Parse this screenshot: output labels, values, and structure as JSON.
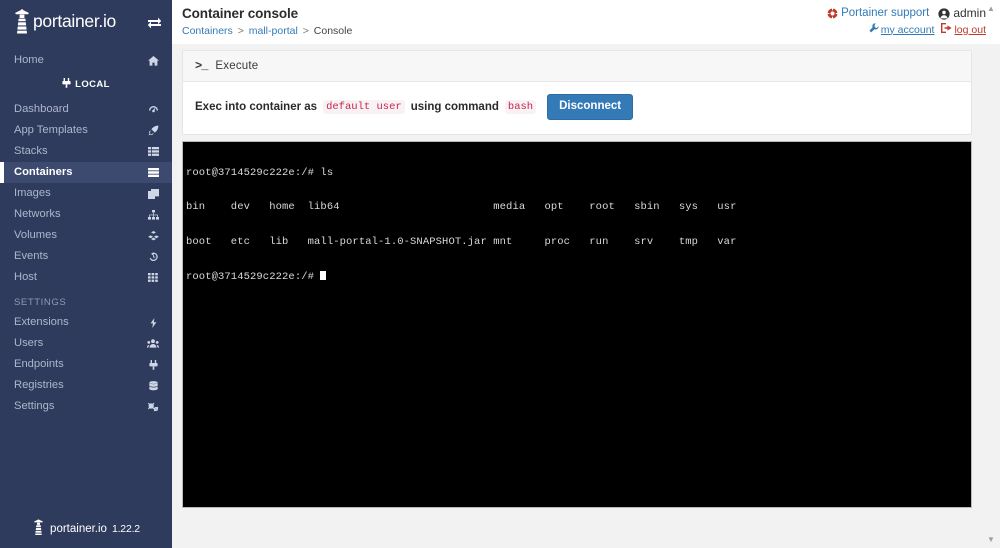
{
  "brand": {
    "name": "portainer.io",
    "version": "1.22.2",
    "toggle_icon": "exchange-arrows-icon",
    "logo_icon": "lighthouse-logo-icon"
  },
  "sidebar": {
    "home": {
      "label": "Home",
      "icon": "home-icon"
    },
    "endpoint": {
      "label": "LOCAL",
      "icon": "plug-icon"
    },
    "items": [
      {
        "label": "Dashboard",
        "icon": "tachometer-icon",
        "active": false
      },
      {
        "label": "App Templates",
        "icon": "rocket-icon",
        "active": false
      },
      {
        "label": "Stacks",
        "icon": "th-list-icon",
        "active": false
      },
      {
        "label": "Containers",
        "icon": "server-icon",
        "active": true
      },
      {
        "label": "Images",
        "icon": "clone-icon",
        "active": false
      },
      {
        "label": "Networks",
        "icon": "sitemap-icon",
        "active": false
      },
      {
        "label": "Volumes",
        "icon": "cubes-icon",
        "active": false
      },
      {
        "label": "Events",
        "icon": "history-icon",
        "active": false
      },
      {
        "label": "Host",
        "icon": "th-icon",
        "active": false
      }
    ],
    "settings_title": "SETTINGS",
    "settings_items": [
      {
        "label": "Extensions",
        "icon": "bolt-icon"
      },
      {
        "label": "Users",
        "icon": "users-icon"
      },
      {
        "label": "Endpoints",
        "icon": "plug-icon"
      },
      {
        "label": "Registries",
        "icon": "database-icon"
      },
      {
        "label": "Settings",
        "icon": "cogs-icon"
      }
    ]
  },
  "header": {
    "title": "Container console",
    "breadcrumb": {
      "root": "Containers",
      "container": "mall-portal",
      "current": "Console",
      "separator": ">"
    },
    "support_label": "Portainer support",
    "support_icon": "life-ring-icon",
    "user_name": "admin",
    "user_icon": "user-circle-icon",
    "my_account_label": "my account",
    "my_account_icon": "wrench-icon",
    "logout_label": "log out",
    "logout_icon": "sign-out-icon"
  },
  "execute_panel": {
    "title": "Execute",
    "title_icon": "terminal-prompt-icon",
    "text_prefix": "Exec into container as",
    "user_code": "default user",
    "text_middle": "using command",
    "command_code": "bash",
    "button_label": "Disconnect"
  },
  "terminal": {
    "scroll_up_icon": "scroll-up-arrow-icon",
    "scroll_down_icon": "scroll-down-arrow-icon",
    "lines": [
      "root@3714529c222e:/# ls",
      "bin    dev   home  lib64                        media   opt    root   sbin   sys   usr",
      "boot   etc   lib   mall-portal-1.0-SNAPSHOT.jar mnt     proc   run    srv    tmp   var"
    ],
    "prompt": "root@3714529c222e:/# "
  },
  "colors": {
    "sidebar_bg": "#2f3b5c",
    "sidebar_active_bg": "#3c4a70",
    "accent_blue": "#337ab7",
    "danger_red": "#c0392b",
    "code_red": "#c7254e",
    "terminal_bg": "#000000",
    "page_bg": "#f2f2f2"
  }
}
